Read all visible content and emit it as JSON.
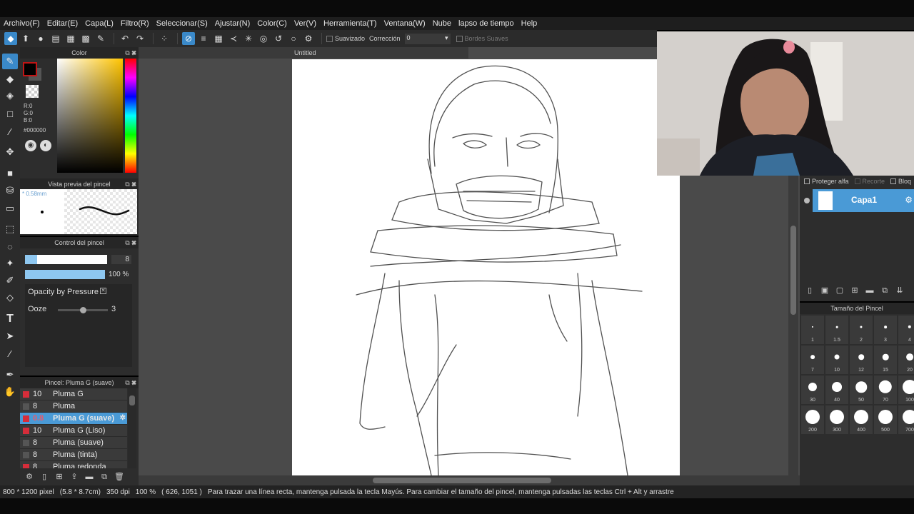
{
  "menu": [
    "Archivo(F)",
    "Editar(E)",
    "Capa(L)",
    "Filtro(R)",
    "Seleccionar(S)",
    "Ajustar(N)",
    "Color(C)",
    "Ver(V)",
    "Herramienta(T)",
    "Ventana(W)",
    "Nube",
    "lapso de tiempo",
    "Help"
  ],
  "toolbar": {
    "suavizado_label": "Suavizado",
    "correccion_label": "Corrección",
    "correccion_value": "0",
    "bordes_label": "Bordes Suaves"
  },
  "color_panel": {
    "title": "Color",
    "r": "R:0",
    "g": "G:0",
    "b": "B:0",
    "hex": "#000000",
    "fg_color": "#000000",
    "accent": "#c01515"
  },
  "brush_preview": {
    "title": "Vista previa del pincel",
    "size_text": "* 0.58mm"
  },
  "brush_control": {
    "title": "Control del pincel",
    "size_value": "8",
    "opacity_value": "100 %",
    "opacity_by_pressure": "Opacity by Pressure",
    "ooze_label": "Ooze",
    "ooze_value": "3",
    "size_fraction": 0.15,
    "ooze_fraction": 0.5
  },
  "brush_list": {
    "title": "Pincel: Pluma G (suave)",
    "items": [
      {
        "size": "10",
        "name": "Pluma G",
        "color": "#d62d3a"
      },
      {
        "size": "8",
        "name": "Pluma",
        "color": "#555555"
      },
      {
        "size": "0.8",
        "name": "Pluma G (suave)",
        "color": "#d62d3a"
      },
      {
        "size": "10",
        "name": "Pluma G (Liso)",
        "color": "#d62d3a"
      },
      {
        "size": "8",
        "name": "Pluma (suave)",
        "color": "#555555"
      },
      {
        "size": "8",
        "name": "Pluma (tinta)",
        "color": "#555555"
      },
      {
        "size": "8",
        "name": "Pluma redonda",
        "color": "#d62d3a"
      }
    ],
    "selected_index": 2
  },
  "document": {
    "tab_title": "Untitled"
  },
  "layers": {
    "protect_alpha": "Proteger alfa",
    "clipping": "Recorte",
    "lock": "Bloq",
    "layer_name": "Capa1"
  },
  "brush_size_panel": {
    "title": "Tamaño del Pincel",
    "sizes": [
      "1",
      "1.5",
      "2",
      "3",
      "4",
      "7",
      "10",
      "12",
      "15",
      "20",
      "30",
      "40",
      "50",
      "70",
      "100",
      "200",
      "300",
      "400",
      "500",
      "700"
    ]
  },
  "status": {
    "doc_size": "800 * 1200 pixel",
    "doc_cm": "(5.8 * 8.7cm)",
    "dpi": "350 dpi",
    "zoom": "100 %",
    "cursor": "( 626, 1051 )",
    "hint": "Para trazar una línea recta, mantenga pulsada la tecla Mayús. Para cambiar el tamaño del pincel, mantenga pulsadas las teclas Ctrl + Alt y arrastre"
  }
}
